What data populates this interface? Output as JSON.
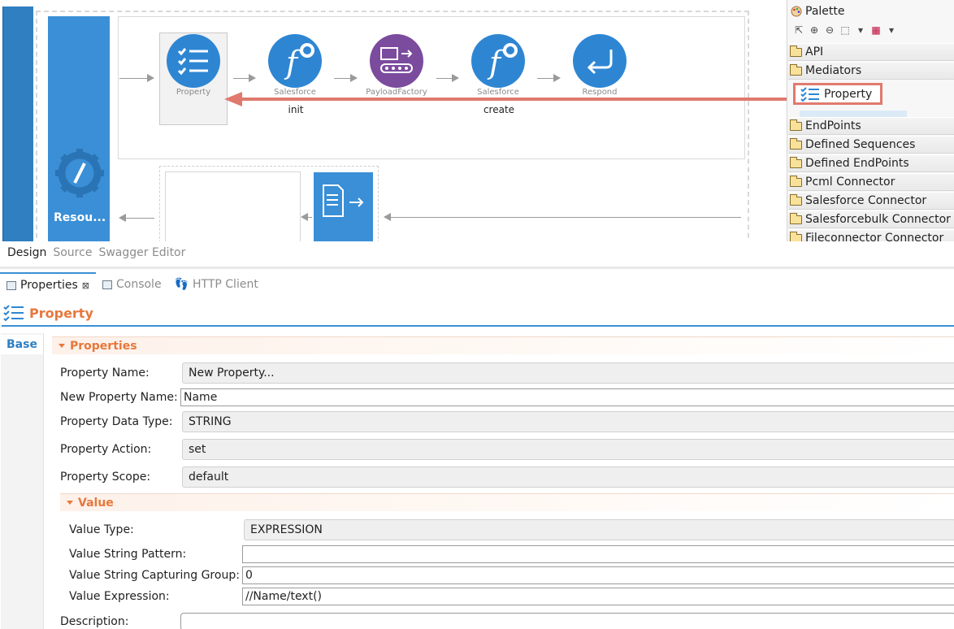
{
  "canvas": {
    "resource_label": "Resou...",
    "mediators": [
      {
        "name": "Property",
        "sub": ""
      },
      {
        "name": "Salesforce",
        "sub": "init"
      },
      {
        "name": "PayloadFactory",
        "sub": ""
      },
      {
        "name": "Salesforce",
        "sub": "create"
      },
      {
        "name": "Respond",
        "sub": ""
      }
    ]
  },
  "palette": {
    "title": "Palette",
    "drawers": [
      "API",
      "Mediators",
      "EndPoints",
      "Defined Sequences",
      "Defined EndPoints",
      "Pcml Connector",
      "Salesforce Connector",
      "Salesforcebulk Connector",
      "Fileconnector Connector"
    ],
    "dragged_item": "Property"
  },
  "editor_tabs": [
    "Design",
    "Source",
    "Swagger Editor"
  ],
  "view_tabs": [
    "Properties",
    "Console",
    "HTTP Client"
  ],
  "properties": {
    "title": "Property",
    "side_tab": "Base",
    "section_title": "Properties",
    "fields": {
      "property_name": {
        "label": "Property Name:",
        "value": "New Property..."
      },
      "new_property_name": {
        "label": "New Property Name:",
        "value": "Name"
      },
      "data_type": {
        "label": "Property Data Type:",
        "value": "STRING"
      },
      "action": {
        "label": "Property Action:",
        "value": "set"
      },
      "scope": {
        "label": "Property Scope:",
        "value": "default"
      }
    },
    "value_section_title": "Value",
    "value_fields": {
      "value_type": {
        "label": "Value Type:",
        "value": "EXPRESSION"
      },
      "string_pattern": {
        "label": "Value String Pattern:",
        "value": ""
      },
      "capturing_group": {
        "label": "Value String Capturing Group:",
        "value": "0"
      },
      "expression": {
        "label": "Value Expression:",
        "value": "//Name/text()"
      }
    },
    "description": {
      "label": "Description:",
      "value": ""
    }
  },
  "colors": {
    "accent_orange": "#e8773b",
    "mediator_blue": "#3a8fd6",
    "payload_purple": "#7b4b9e",
    "drag_arrow": "#e07a6e"
  }
}
